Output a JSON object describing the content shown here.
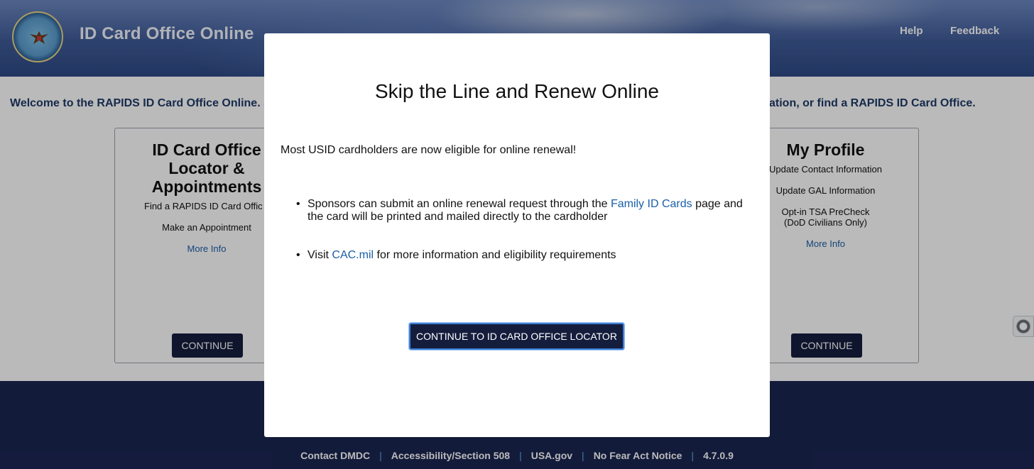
{
  "header": {
    "site_title": "ID Card Office Online",
    "nav": {
      "help": "Help",
      "feedback": "Feedback"
    }
  },
  "content": {
    "welcome_left": "Welcome to the RAPIDS ID Card Office Online. S",
    "welcome_right": "ation, or find a RAPIDS ID Card Office.",
    "cards": [
      {
        "title_lines": [
          "ID Card Office",
          "Locator &",
          "Appointments"
        ],
        "items": [
          "Find a RAPIDS ID Card Offic",
          "Make an Appointment"
        ],
        "more_info": "More Info",
        "button": "CONTINUE"
      },
      {
        "title_lines": [
          "My Profile"
        ],
        "items": [
          "Update Contact Information",
          "Update GAL Information",
          "Opt-in TSA PreCheck",
          "(DoD Civilians Only)"
        ],
        "more_info": "More Info",
        "button": "CONTINUE"
      }
    ]
  },
  "footer": {
    "links": [
      "Contact DMDC",
      "Accessibility/Section 508",
      "USA.gov",
      "No Fear Act Notice"
    ],
    "version": "4.7.0.9"
  },
  "modal": {
    "title": "Skip the Line and Renew Online",
    "intro": "Most USID cardholders are now eligible for online renewal!",
    "bullet1": {
      "before": "Sponsors can submit an online renewal request through the ",
      "link": "Family ID Cards",
      "after": " page and the card will be printed and mailed directly to the cardholder"
    },
    "bullet2": {
      "before": "Visit ",
      "link": "CAC.mil",
      "after": " for more information and eligibility requirements"
    },
    "button": "CONTINUE TO ID CARD OFFICE LOCATOR"
  },
  "icons": {
    "seal": "dod-seal-icon",
    "widget": "accessibility-widget-icon"
  }
}
